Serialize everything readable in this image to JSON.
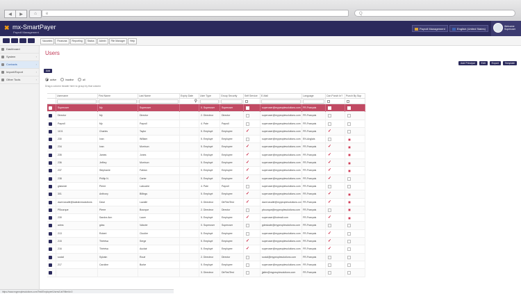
{
  "browser": {
    "address": "e",
    "search": "Q",
    "nav_back": "◀",
    "nav_forward": "▶",
    "home": "⌂"
  },
  "app": {
    "logo_mark": "✖",
    "logo": "mx-SmartPayer",
    "logo_sub": "Payroll Management",
    "payroll_management": "Payroll Management",
    "language": "English (United States)",
    "user": "Welcome Superuser"
  },
  "menu": [
    "Vacantes",
    "Finanzas",
    "Reporting",
    "Status",
    "Admin",
    "File Manager",
    "Help"
  ],
  "sidebar": [
    {
      "label": "Dashboard",
      "arrow": ""
    },
    {
      "label": "System",
      "arrow": "›"
    },
    {
      "label": "Contacts",
      "arrow": "›"
    },
    {
      "label": "Import/Export",
      "arrow": "›"
    },
    {
      "label": "Other Tools",
      "arrow": "›"
    }
  ],
  "page_title": "Users",
  "actions": [
    "Add Principal",
    "Edit",
    "Export",
    "Template"
  ],
  "add_button": "Add",
  "radios": [
    "active",
    "inactive",
    "all"
  ],
  "group_hint": "Drag a column header here to group by that column",
  "grid": {
    "headers": [
      "",
      "Username",
      "First Name",
      "Last Name",
      "Expiry Date",
      "User Type",
      "Group Security",
      "Self Service",
      "E-Mail",
      "Language",
      "Can Punch In?",
      "Punch By Sup"
    ],
    "rows": [
      {
        "u": "Superuser",
        "f": "My",
        "l": "Superuser",
        "e": "",
        "t": "0. Superuser",
        "g": "Superuser",
        "ss": 0,
        "m": "superuser@mypeoplesolutions.com",
        "lang": "FR-Français",
        "cp": 0,
        "pbs": 0
      },
      {
        "u": "Director",
        "f": "My",
        "l": "Director",
        "e": "",
        "t": "2. Directeur",
        "g": "Director",
        "ss": 0,
        "m": "superuser@mypeoplesolutions.com",
        "lang": "FR-Français",
        "cp": 0,
        "pbs": 0
      },
      {
        "u": "Payroll",
        "f": "My",
        "l": "Payroll",
        "e": "",
        "t": "4. Paie",
        "g": "Payroll",
        "ss": 0,
        "m": "superuser@mypeoplesolutions.com",
        "lang": "FR-Français",
        "cp": 0,
        "pbs": 0
      },
      {
        "u": "1101",
        "f": "Charles",
        "l": "Taylor",
        "e": "",
        "t": "5. Employé",
        "g": "Employee",
        "ss": 1,
        "m": "superuser@mypeoplesolutions.com",
        "lang": "FR-Français",
        "cp": 1,
        "pbs": 0
      },
      {
        "u": "230",
        "f": "Ivan",
        "l": "William",
        "e": "",
        "t": "5. Employé",
        "g": "Employee",
        "ss": 0,
        "m": "superuser@mypeoplesolutions.com",
        "lang": "EN-Anglais",
        "cp": 0,
        "pbs": 2
      },
      {
        "u": "234",
        "f": "Ivan",
        "l": "Morrison",
        "e": "",
        "t": "5. Employé",
        "g": "Employee",
        "ss": 1,
        "m": "superuser@mypeoplesolutions.com",
        "lang": "FR-Français",
        "cp": 1,
        "pbs": 2
      },
      {
        "u": "235",
        "f": "James",
        "l": "Jones",
        "e": "",
        "t": "5. Employé",
        "g": "Employee",
        "ss": 1,
        "m": "superuser@mypeoplesolutions.com",
        "lang": "FR-Français",
        "cp": 1,
        "pbs": 2
      },
      {
        "u": "236",
        "f": "Jeffrey",
        "l": "Morrison",
        "e": "",
        "t": "5. Employé",
        "g": "Employee",
        "ss": 1,
        "m": "superuser@mypeoplesolutions.com",
        "lang": "FR-Français",
        "cp": 1,
        "pbs": 2
      },
      {
        "u": "237",
        "f": "Stephanie",
        "l": "Fabian",
        "e": "",
        "t": "5. Employé",
        "g": "Employee",
        "ss": 1,
        "m": "superuser@mypeoplesolutions.com",
        "lang": "FR-Français",
        "cp": 1,
        "pbs": 2
      },
      {
        "u": "238",
        "f": "Phillip N.",
        "l": "Carter",
        "e": "",
        "t": "5. Employé",
        "g": "Employee",
        "ss": 1,
        "m": "superuser@mypeoplesolutions.com",
        "lang": "FR-Français",
        "cp": 1,
        "pbs": 0
      },
      {
        "u": "glalonde",
        "f": "Pierre",
        "l": "Lalouche",
        "e": "",
        "t": "4. Paie",
        "g": "Payroll",
        "ss": 0,
        "m": "superuser@mypeoplesolutions.com",
        "lang": "FR-Français",
        "cp": 0,
        "pbs": 0
      },
      {
        "u": "301",
        "f": "Anthony",
        "l": "Billings",
        "e": "",
        "t": "5. Employé",
        "g": "Employee",
        "ss": 1,
        "m": "superuser@mypeoplesolutions.com",
        "lang": "FR-Français",
        "cp": 1,
        "pbs": 2
      },
      {
        "u": "dave.lavallé@kalealvmsolutions",
        "f": "Dave",
        "l": "Lavallé",
        "e": "",
        "t": "3. Directeur",
        "g": "DirFiedTest",
        "ss": 1,
        "m": "dave.lavallé@mypeoplesolutions.com",
        "lang": "FR-Français",
        "cp": 1,
        "pbs": 2
      },
      {
        "u": "PBourque",
        "f": "Pierre",
        "l": "Bourque",
        "e": "",
        "t": "2. Directeur",
        "g": "Director",
        "ss": 0,
        "m": "pbourque@mypeoplesolutions.com",
        "lang": "FR-Français",
        "cp": 0,
        "pbs": 2
      },
      {
        "u": "239",
        "f": "Sandra Ann",
        "l": "Lauer",
        "e": "",
        "t": "5. Employé",
        "g": "Employee",
        "ss": 1,
        "m": "superuser@hotmail.com",
        "lang": "FR-Français",
        "cp": 1,
        "pbs": 2
      },
      {
        "u": "adms",
        "f": "gdss",
        "l": "Valcote",
        "e": "",
        "t": "0. Superuser",
        "g": "Superuser",
        "ss": 0,
        "m": "gdesicate@mypeoplesolutions.com",
        "lang": "FR-Français",
        "cp": 0,
        "pbs": 0
      },
      {
        "u": "213",
        "f": "Robert",
        "l": "Cloutier",
        "e": "",
        "t": "5. Employé",
        "g": "Employee",
        "ss": 0,
        "m": "superuser@mypeoplesolutions.com",
        "lang": "FR-Français",
        "cp": 1,
        "pbs": 0
      },
      {
        "u": "215",
        "f": "Thérèsa",
        "l": "Serge",
        "e": "",
        "t": "5. Employé",
        "g": "Employee",
        "ss": 1,
        "m": "superuser@mypeoplesolutions.com",
        "lang": "FR-Français",
        "cp": 1,
        "pbs": 0
      },
      {
        "u": "216",
        "f": "Thérèsa",
        "l": "Auclair",
        "e": "",
        "t": "5. Employé",
        "g": "Employee",
        "ss": 1,
        "m": "superuser@mypeoplesolutions.com",
        "lang": "FR-Français",
        "cp": 1,
        "pbs": 0
      },
      {
        "u": "social",
        "f": "Sylvain",
        "l": "Roué",
        "e": "",
        "t": "2. Directeur",
        "g": "Director",
        "ss": 0,
        "m": "social@mypeoplesolutions.com",
        "lang": "FR-Français",
        "cp": 0,
        "pbs": 0
      },
      {
        "u": "217",
        "f": "Caroline",
        "l": "Burke",
        "e": "",
        "t": "5. Employé",
        "g": "Employee",
        "ss": 0,
        "m": "superuser@mypeoplesolutions.com",
        "lang": "FR-Français",
        "cp": 0,
        "pbs": 0
      },
      {
        "u": "",
        "f": "",
        "l": "",
        "e": "",
        "t": "3. Directeur",
        "g": "DirFiedTest",
        "ss": 0,
        "m": "jjaller@mypeoplesolutions.com",
        "lang": "FR-Français",
        "cp": 0,
        "pbs": 0
      }
    ],
    "selected_row": 0,
    "filter_icon": "⚲"
  },
  "status": "https://www.mypeoplesolutions.com/Test/Employee/Users/List?filterId=0"
}
